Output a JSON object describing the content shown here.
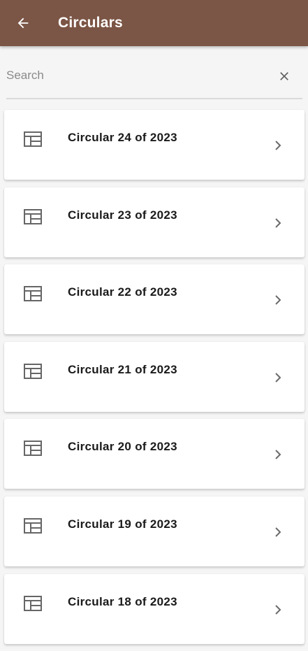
{
  "colors": {
    "appbar": "#7b5545",
    "icon": "#666666",
    "chevron": "#6a6a6a"
  },
  "appbar": {
    "title": "Circulars",
    "back_icon": "arrow-left-icon"
  },
  "search": {
    "placeholder": "Search",
    "value": "",
    "clear_icon": "close-icon"
  },
  "circulars": [
    {
      "title": "Circular 24 of 2023",
      "icon": "table-document-icon"
    },
    {
      "title": "Circular 23 of 2023",
      "icon": "table-document-icon"
    },
    {
      "title": "Circular 22 of 2023",
      "icon": "table-document-icon"
    },
    {
      "title": "Circular 21 of 2023",
      "icon": "table-document-icon"
    },
    {
      "title": "Circular 20 of 2023",
      "icon": "table-document-icon"
    },
    {
      "title": "Circular 19 of 2023",
      "icon": "table-document-icon"
    },
    {
      "title": "Circular 18 of 2023",
      "icon": "table-document-icon"
    }
  ]
}
